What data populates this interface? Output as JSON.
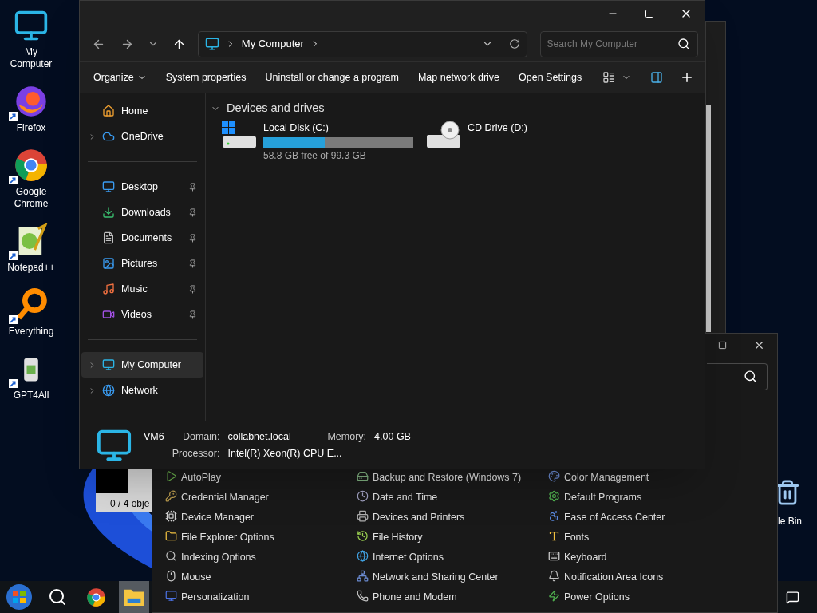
{
  "desktop_icons": [
    {
      "label": "My Computer"
    },
    {
      "label": "Firefox"
    },
    {
      "label": "Google Chrome"
    },
    {
      "label": "Notepad++"
    },
    {
      "label": "Everything"
    },
    {
      "label": "GPT4All"
    }
  ],
  "recycle_bin": {
    "label": "le Bin"
  },
  "background_window": {
    "status": "0 / 4 obje"
  },
  "control_panel": {
    "items": [
      {
        "label": "AutoPlay"
      },
      {
        "label": "Backup and Restore (Windows 7)"
      },
      {
        "label": "Color Management"
      },
      {
        "label": "Credential Manager"
      },
      {
        "label": "Date and Time"
      },
      {
        "label": "Default Programs"
      },
      {
        "label": "Device Manager"
      },
      {
        "label": "Devices and Printers"
      },
      {
        "label": "Ease of Access Center"
      },
      {
        "label": "File Explorer Options"
      },
      {
        "label": "File History"
      },
      {
        "label": "Fonts"
      },
      {
        "label": "Indexing Options"
      },
      {
        "label": "Internet Options"
      },
      {
        "label": "Keyboard"
      },
      {
        "label": "Mouse"
      },
      {
        "label": "Network and Sharing Center"
      },
      {
        "label": "Notification Area Icons"
      },
      {
        "label": "Personalization"
      },
      {
        "label": "Phone and Modem"
      },
      {
        "label": "Power Options"
      }
    ]
  },
  "explorer": {
    "address": "My Computer",
    "search": {
      "placeholder": "Search My Computer"
    },
    "commands": [
      "Organize",
      "System properties",
      "Uninstall or change a program",
      "Map network drive",
      "Open Settings"
    ],
    "sidebar": [
      {
        "label": "Home",
        "expandable": false,
        "pinned": false,
        "selected": false
      },
      {
        "label": "OneDrive",
        "expandable": true,
        "pinned": false,
        "selected": false
      },
      {
        "label": "Desktop",
        "expandable": false,
        "pinned": true,
        "selected": false
      },
      {
        "label": "Downloads",
        "expandable": false,
        "pinned": true,
        "selected": false
      },
      {
        "label": "Documents",
        "expandable": false,
        "pinned": true,
        "selected": false
      },
      {
        "label": "Pictures",
        "expandable": false,
        "pinned": true,
        "selected": false
      },
      {
        "label": "Music",
        "expandable": false,
        "pinned": true,
        "selected": false
      },
      {
        "label": "Videos",
        "expandable": false,
        "pinned": true,
        "selected": false
      },
      {
        "label": "My Computer",
        "expandable": true,
        "pinned": false,
        "selected": true
      },
      {
        "label": "Network",
        "expandable": true,
        "pinned": false,
        "selected": false
      }
    ],
    "group": "Devices and drives",
    "drives": [
      {
        "kind": "disk",
        "name": "Local Disk (C:)",
        "level": 0.41,
        "free": "58.8 GB free of 99.3 GB"
      },
      {
        "kind": "optical",
        "name": "CD Drive (D:)"
      }
    ],
    "details": {
      "name": "VM6",
      "fields": [
        {
          "label": "Domain:",
          "value": "collabnet.local"
        },
        {
          "label": "Memory:",
          "value": "4.00 GB"
        },
        {
          "label": "Processor:",
          "value": "Intel(R) Xeon(R) CPU E..."
        }
      ]
    }
  },
  "taskbar": [
    {
      "kind": "start",
      "selected": false
    },
    {
      "kind": "search",
      "selected": false
    },
    {
      "kind": "chrome",
      "selected": false
    },
    {
      "kind": "explorer",
      "selected": true
    }
  ]
}
